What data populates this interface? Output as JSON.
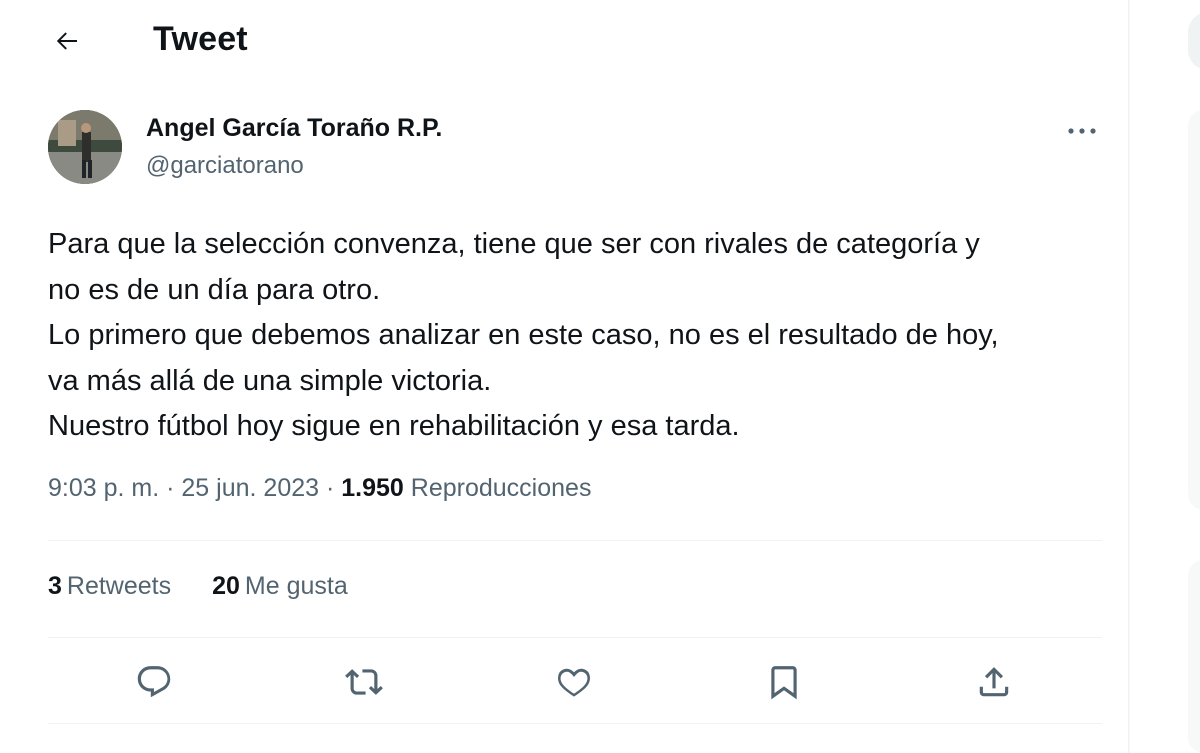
{
  "header": {
    "back_icon": "arrow-left-icon",
    "title": "Tweet"
  },
  "author": {
    "name": "Angel García Toraño R.P.",
    "handle": "@garciatorano",
    "more_icon": "more-horizontal-icon"
  },
  "tweet": {
    "lines": [
      "Para que la selección convenza, tiene que ser con rivales de categoría y",
      "no es de un día para otro.",
      "Lo primero que debemos analizar en este caso, no es el resultado de hoy,",
      "va más allá de una simple victoria.",
      "Nuestro fútbol hoy sigue en rehabilitación y esa tarda."
    ]
  },
  "meta": {
    "time": "9:03 p. m.",
    "separator": "·",
    "date": "25 jun. 2023",
    "views_count": "1.950",
    "views_label": "Reproducciones"
  },
  "stats": {
    "retweets_count": "3",
    "retweets_label": "Retweets",
    "likes_count": "20",
    "likes_label": "Me gusta"
  },
  "actions": [
    {
      "name": "reply",
      "icon": "reply-icon"
    },
    {
      "name": "retweet",
      "icon": "retweet-icon"
    },
    {
      "name": "like",
      "icon": "heart-icon"
    },
    {
      "name": "bookmark",
      "icon": "bookmark-icon"
    },
    {
      "name": "share",
      "icon": "share-icon"
    }
  ],
  "colors": {
    "text_primary": "#0f1419",
    "text_secondary": "#536471",
    "divider": "#eff3f4"
  }
}
